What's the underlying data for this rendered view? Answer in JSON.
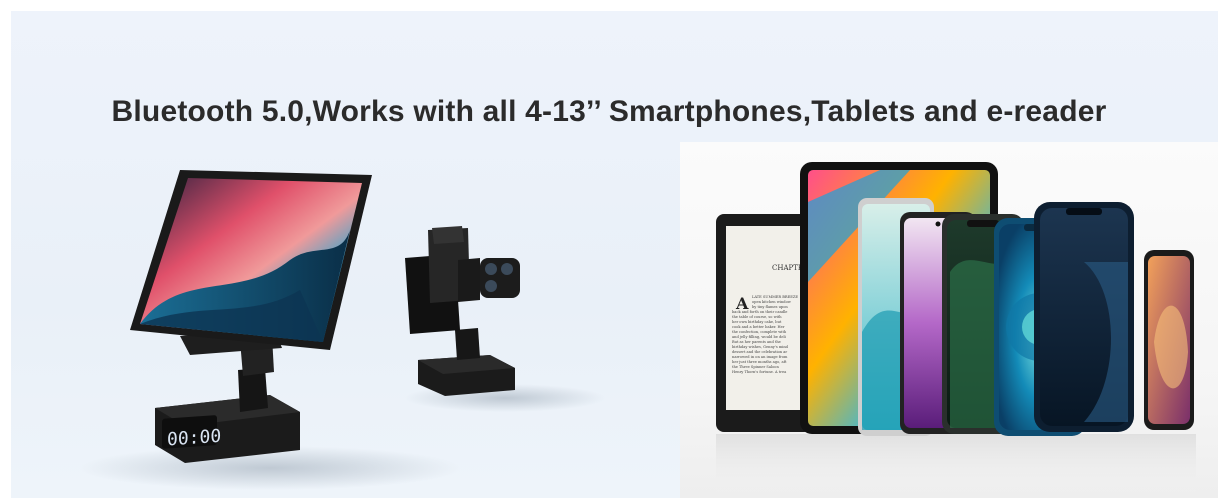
{
  "headline": "Bluetooth 5.0,Works with all 4-13’’ Smartphones,Tablets and e-reader",
  "clock": {
    "display": "00:00"
  },
  "ereader": {
    "chapter": "CHAPTE",
    "text_lines": [
      "LATE SUMMER BREEZE",
      "open kitchen window",
      "by tiny flames upon",
      "back and forth on their candle",
      "the table of course, so with",
      "her own birthday cake, but",
      "cook and a better baker. Her",
      "the confection, complete with",
      "and jelly filling, would be deli",
      "But as her parents and the",
      "birthday wishes, Genny's mind",
      "dessert and the celebration ar",
      "narrowed in on an image from",
      "her just three months ago, aft",
      "the Three Spinner Saloon",
      "Henry Thorn's fortune. A trea"
    ]
  },
  "colors": {
    "background": "#eaf1f9",
    "headline": "#2b2b2b",
    "device_body": "#1c1c1c",
    "clock_digits": "#d9e4f2"
  }
}
